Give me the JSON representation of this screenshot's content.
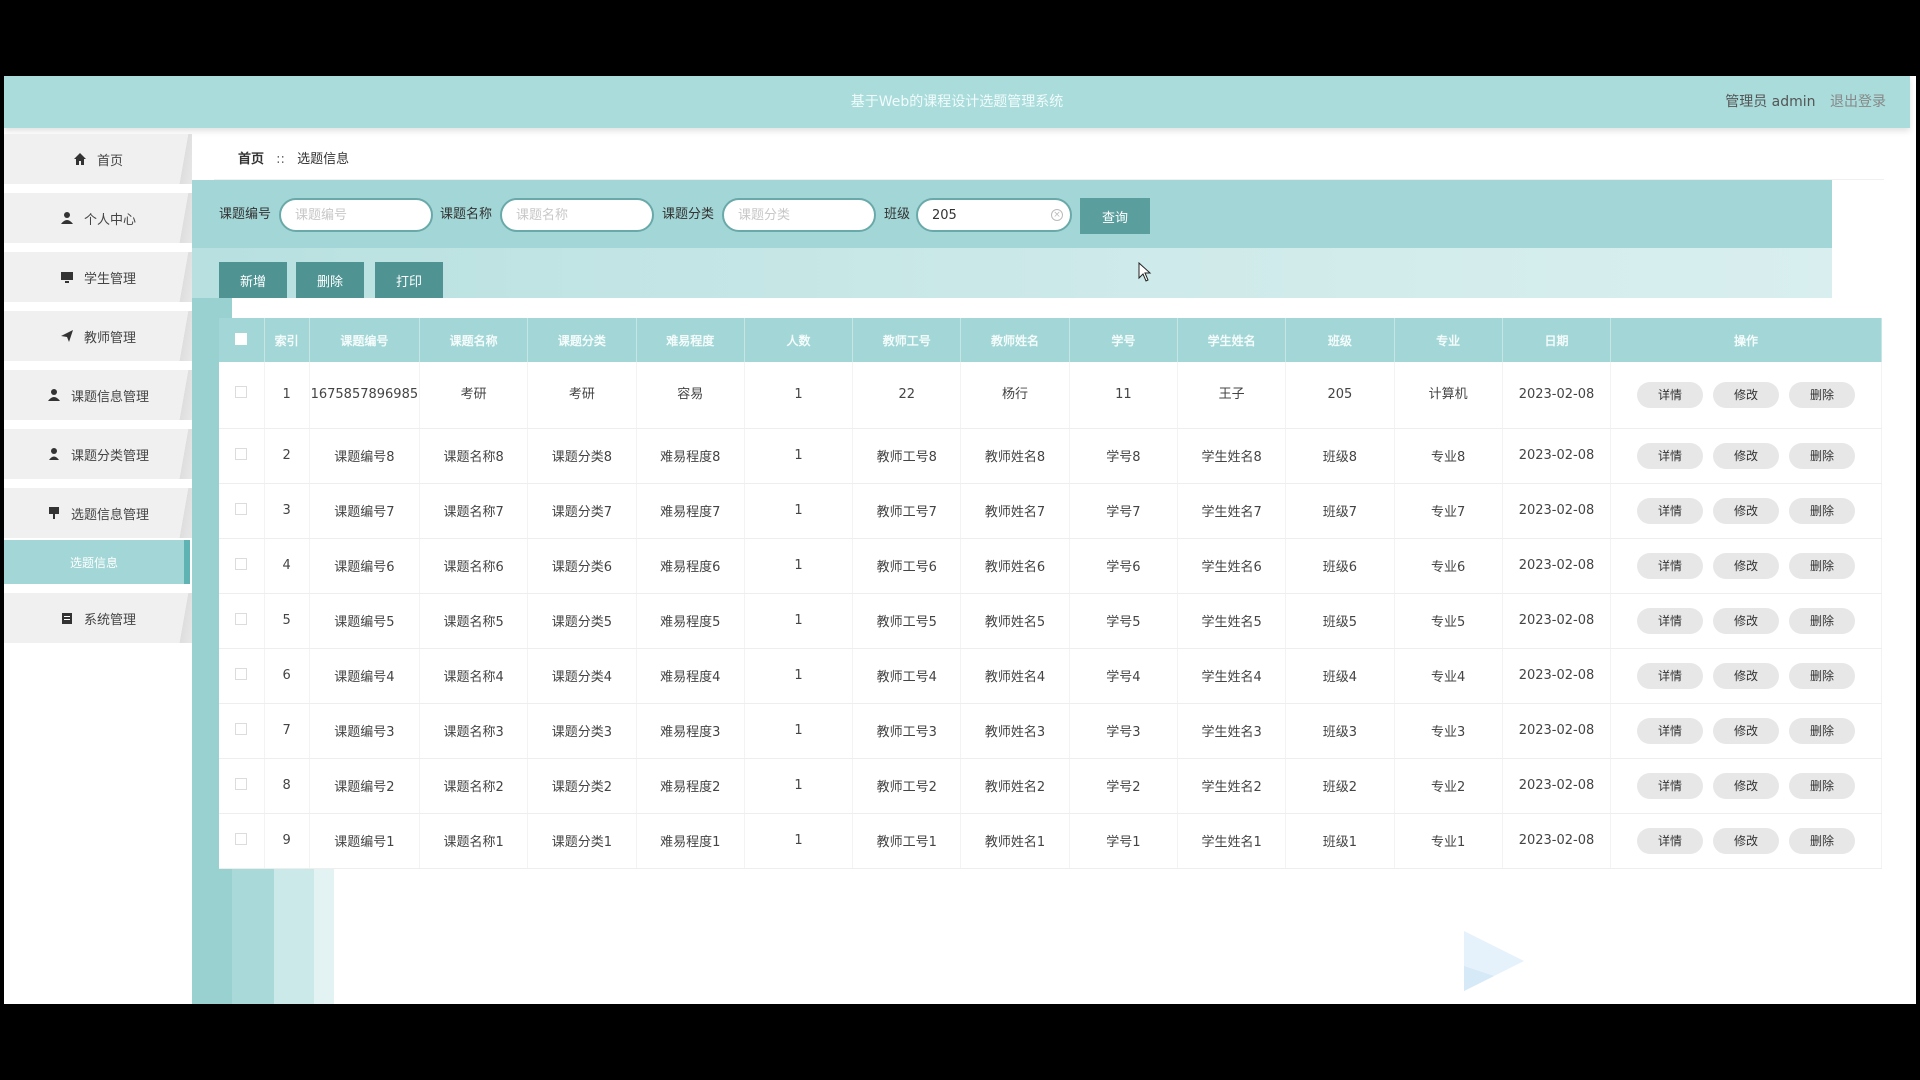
{
  "header": {
    "title": "基于Web的课程设计选题管理系统",
    "user": "管理员 admin",
    "logout": "退出登录"
  },
  "sidebar": {
    "items": [
      {
        "label": "首页",
        "icon": "home-icon"
      },
      {
        "label": "个人中心",
        "icon": "user-icon"
      },
      {
        "label": "学生管理",
        "icon": "monitor-icon"
      },
      {
        "label": "教师管理",
        "icon": "send-icon"
      },
      {
        "label": "课题信息管理",
        "icon": "users-icon"
      },
      {
        "label": "课题分类管理",
        "icon": "user-icon"
      },
      {
        "label": "选题信息管理",
        "icon": "pin-icon"
      },
      {
        "label": "系统管理",
        "icon": "clipboard-icon"
      }
    ],
    "sub_item": "选题信息"
  },
  "breadcrumb": {
    "home": "首页",
    "sep": "::",
    "current": "选题信息"
  },
  "search": {
    "f1_label": "课题编号",
    "f1_placeholder": "课题编号",
    "f1_value": "",
    "f2_label": "课题名称",
    "f2_placeholder": "课题名称",
    "f2_value": "",
    "f3_label": "课题分类",
    "f3_placeholder": "课题分类",
    "f3_value": "",
    "f4_label": "班级",
    "f4_placeholder": "",
    "f4_value": "205",
    "query_label": "查询"
  },
  "toolbar": {
    "add": "新增",
    "delete": "删除",
    "print": "打印"
  },
  "table": {
    "headers": [
      "索引",
      "课题编号",
      "课题名称",
      "课题分类",
      "难易程度",
      "人数",
      "教师工号",
      "教师姓名",
      "学号",
      "学生姓名",
      "班级",
      "专业",
      "日期",
      "操作"
    ],
    "actions": {
      "detail": "详情",
      "edit": "修改",
      "delete": "删除"
    },
    "rows": [
      [
        "1",
        "1675857896985",
        "考研",
        "考研",
        "容易",
        "1",
        "22",
        "杨行",
        "11",
        "王子",
        "205",
        "计算机",
        "2023-02-08"
      ],
      [
        "2",
        "课题编号8",
        "课题名称8",
        "课题分类8",
        "难易程度8",
        "1",
        "教师工号8",
        "教师姓名8",
        "学号8",
        "学生姓名8",
        "班级8",
        "专业8",
        "2023-02-08"
      ],
      [
        "3",
        "课题编号7",
        "课题名称7",
        "课题分类7",
        "难易程度7",
        "1",
        "教师工号7",
        "教师姓名7",
        "学号7",
        "学生姓名7",
        "班级7",
        "专业7",
        "2023-02-08"
      ],
      [
        "4",
        "课题编号6",
        "课题名称6",
        "课题分类6",
        "难易程度6",
        "1",
        "教师工号6",
        "教师姓名6",
        "学号6",
        "学生姓名6",
        "班级6",
        "专业6",
        "2023-02-08"
      ],
      [
        "5",
        "课题编号5",
        "课题名称5",
        "课题分类5",
        "难易程度5",
        "1",
        "教师工号5",
        "教师姓名5",
        "学号5",
        "学生姓名5",
        "班级5",
        "专业5",
        "2023-02-08"
      ],
      [
        "6",
        "课题编号4",
        "课题名称4",
        "课题分类4",
        "难易程度4",
        "1",
        "教师工号4",
        "教师姓名4",
        "学号4",
        "学生姓名4",
        "班级4",
        "专业4",
        "2023-02-08"
      ],
      [
        "7",
        "课题编号3",
        "课题名称3",
        "课题分类3",
        "难易程度3",
        "1",
        "教师工号3",
        "教师姓名3",
        "学号3",
        "学生姓名3",
        "班级3",
        "专业3",
        "2023-02-08"
      ],
      [
        "8",
        "课题编号2",
        "课题名称2",
        "课题分类2",
        "难易程度2",
        "1",
        "教师工号2",
        "教师姓名2",
        "学号2",
        "学生姓名2",
        "班级2",
        "专业2",
        "2023-02-08"
      ],
      [
        "9",
        "课题编号1",
        "课题名称1",
        "课题分类1",
        "难易程度1",
        "1",
        "教师工号1",
        "教师姓名1",
        "学号1",
        "学生姓名1",
        "班级1",
        "专业1",
        "2023-02-08"
      ]
    ]
  },
  "colors": {
    "accent": "#a3d6d6",
    "button": "#4f9393",
    "header": "#a9dcdb"
  }
}
